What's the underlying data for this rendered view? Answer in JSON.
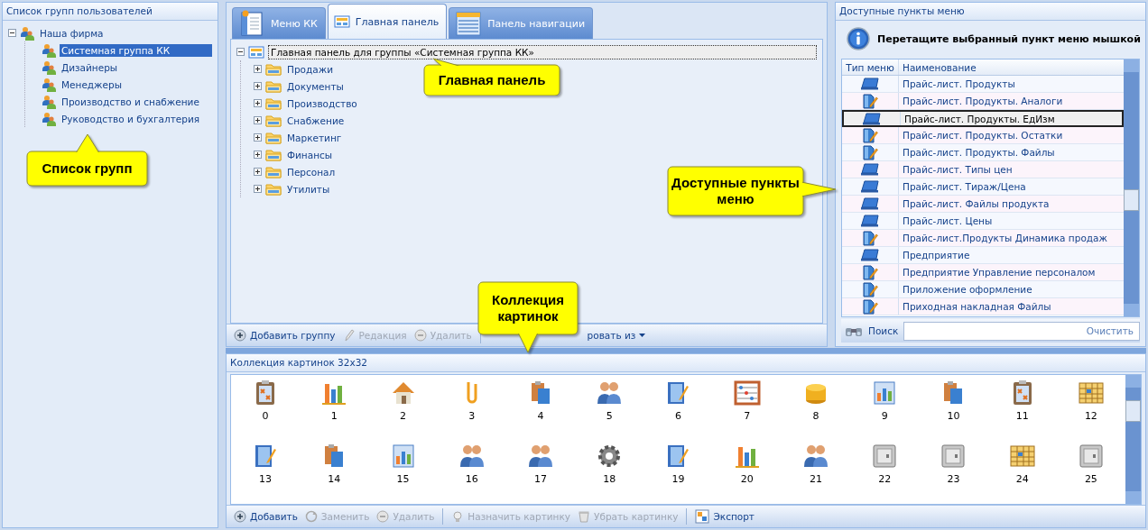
{
  "groups_panel": {
    "title": "Список групп пользователей",
    "tree": [
      {
        "label": "Наша фирма",
        "expanded": true,
        "selected": false,
        "children": [
          {
            "label": "Системная группа КК",
            "selected": true
          },
          {
            "label": "Дизайнеры",
            "selected": false
          },
          {
            "label": "Менеджеры",
            "selected": false
          },
          {
            "label": "Производство и снабжение",
            "selected": false
          },
          {
            "label": "Руководство и бухгалтерия",
            "selected": false
          }
        ]
      }
    ]
  },
  "main_panel": {
    "tabs": [
      {
        "label": "Меню КК",
        "selected": false
      },
      {
        "label": "Главная панель",
        "selected": true
      },
      {
        "label": "Панель навигации",
        "selected": false
      }
    ],
    "tree": [
      {
        "label": "Главная панель для группы «Системная группа КК»",
        "expanded": true,
        "selected": true,
        "children": [
          {
            "label": "Продажи",
            "expanded": false,
            "selected": false
          },
          {
            "label": "Документы",
            "expanded": false,
            "selected": false
          },
          {
            "label": "Производство",
            "expanded": false,
            "selected": false
          },
          {
            "label": "Снабжение",
            "expanded": false,
            "selected": false
          },
          {
            "label": "Маркетинг",
            "expanded": false,
            "selected": false
          },
          {
            "label": "Финансы",
            "expanded": false,
            "selected": false
          },
          {
            "label": "Персонал",
            "expanded": false,
            "selected": false
          },
          {
            "label": "Утилиты",
            "expanded": false,
            "selected": false
          }
        ]
      }
    ],
    "toolbar": [
      {
        "kind": "button",
        "label": "Добавить группу",
        "disabled": false
      },
      {
        "kind": "button",
        "label": "Редакция",
        "disabled": true
      },
      {
        "kind": "button",
        "label": "Удалить",
        "disabled": true
      },
      {
        "kind": "separator"
      },
      {
        "kind": "dropdown",
        "label": "ровать из",
        "disabled": false
      }
    ]
  },
  "menu_items_panel": {
    "title": "Доступные пункты меню",
    "hint": "Перетащите выбранный пункт меню мышкой",
    "columns": [
      "Тип меню",
      "Наименование"
    ],
    "rows": [
      {
        "kind": "form",
        "name": "Прайс-лист. Продукты",
        "selected": false
      },
      {
        "kind": "report",
        "name": "Прайс-лист. Продукты. Аналоги",
        "selected": false
      },
      {
        "kind": "form",
        "name": "Прайс-лист. Продукты. ЕдИзм",
        "selected": true
      },
      {
        "kind": "report",
        "name": "Прайс-лист. Продукты. Остатки",
        "selected": false
      },
      {
        "kind": "report",
        "name": "Прайс-лист. Продукты. Файлы",
        "selected": false
      },
      {
        "kind": "form",
        "name": "Прайс-лист. Типы цен",
        "selected": false
      },
      {
        "kind": "form",
        "name": "Прайс-лист. Тираж/Цена",
        "selected": false
      },
      {
        "kind": "form",
        "name": "Прайс-лист. Файлы продукта",
        "selected": false
      },
      {
        "kind": "form",
        "name": "Прайс-лист. Цены",
        "selected": false
      },
      {
        "kind": "report",
        "name": "Прайс-лист.Продукты Динамика продаж",
        "selected": false
      },
      {
        "kind": "form",
        "name": "Предприятие",
        "selected": false
      },
      {
        "kind": "report",
        "name": "Предприятие Управление персоналом",
        "selected": false
      },
      {
        "kind": "report",
        "name": "Приложение оформление",
        "selected": false
      },
      {
        "kind": "report",
        "name": "Приходная накладная Файлы",
        "selected": false
      }
    ],
    "search": {
      "label": "Поиск",
      "clear": "Очистить"
    }
  },
  "images_panel": {
    "title": "Коллекция картинок 32x32",
    "images": [
      "0",
      "1",
      "2",
      "3",
      "4",
      "5",
      "6",
      "7",
      "8",
      "9",
      "10",
      "11",
      "12",
      "13",
      "14",
      "15",
      "16",
      "17",
      "18",
      "19",
      "20",
      "21",
      "22",
      "23",
      "24",
      "25"
    ],
    "toolbar": [
      {
        "kind": "button",
        "label": "Добавить",
        "disabled": false
      },
      {
        "kind": "button",
        "label": "Заменить",
        "disabled": true
      },
      {
        "kind": "button",
        "label": "Удалить",
        "disabled": true
      },
      {
        "kind": "separator"
      },
      {
        "kind": "button",
        "label": "Назначить картинку",
        "disabled": true
      },
      {
        "kind": "button",
        "label": "Убрать картинку",
        "disabled": true
      },
      {
        "kind": "separator"
      },
      {
        "kind": "button",
        "label": "Экспорт",
        "disabled": false
      }
    ]
  },
  "callouts": [
    {
      "text": "Список групп",
      "kind": "up"
    },
    {
      "text": "Главная панель",
      "kind": "upleft"
    },
    {
      "text": "Доступные пункты меню",
      "kind": "right"
    },
    {
      "text": "Коллекция картинок",
      "kind": "down"
    }
  ]
}
